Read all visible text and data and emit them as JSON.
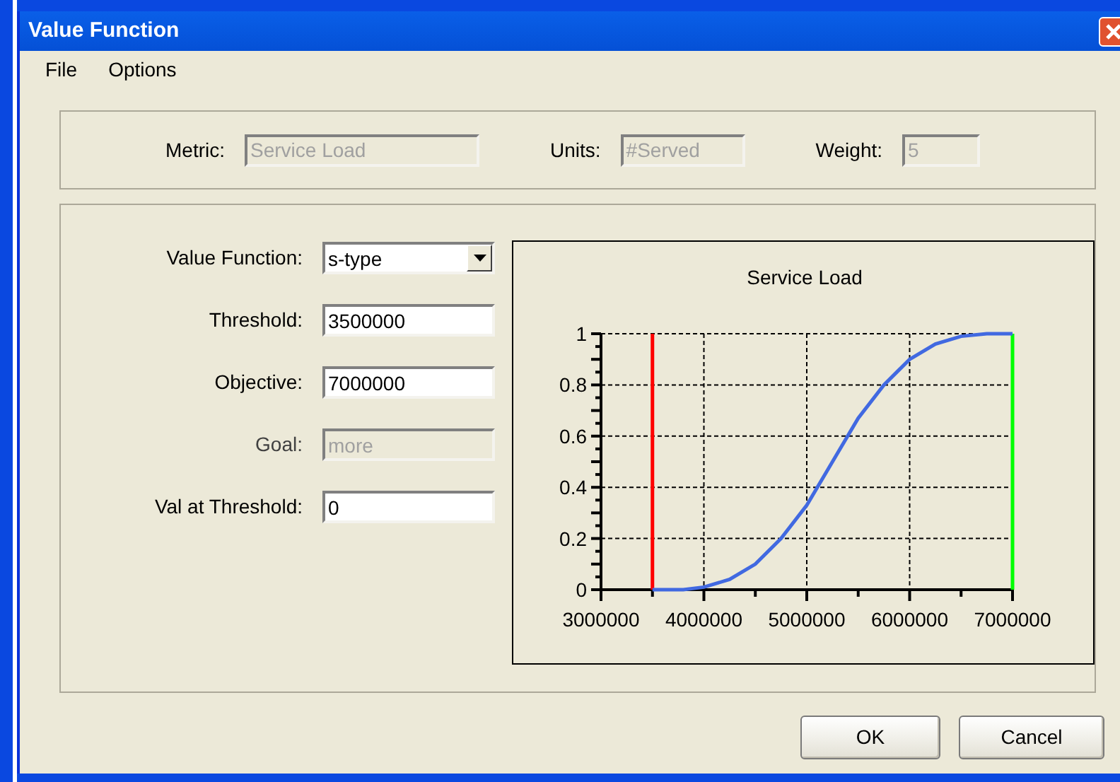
{
  "window": {
    "title": "Value Function"
  },
  "menu": [
    {
      "label": "File"
    },
    {
      "label": "Options"
    }
  ],
  "header_fields": [
    {
      "label": "Metric:",
      "value": "Service Load",
      "disabled": true
    },
    {
      "label": "Units:",
      "value": "#Served",
      "disabled": true
    },
    {
      "label": "Weight:",
      "value": "5",
      "disabled": true
    }
  ],
  "form_fields": [
    {
      "kind": "select",
      "label": "Value Function:",
      "value": "s-type",
      "disabled": false
    },
    {
      "kind": "text",
      "label": "Threshold:",
      "value": "3500000",
      "disabled": false
    },
    {
      "kind": "text",
      "label": "Objective:",
      "value": "7000000",
      "disabled": false
    },
    {
      "kind": "text",
      "label": "Goal:",
      "value": "more",
      "disabled": true
    },
    {
      "kind": "text",
      "label": "Val at Threshold:",
      "value": "0",
      "disabled": false
    }
  ],
  "chart": {
    "chart_data": {
      "type": "line",
      "title": "Service Load",
      "x": [
        3500000,
        3800000,
        4000000,
        4250000,
        4500000,
        4750000,
        5000000,
        5250000,
        5500000,
        5750000,
        6000000,
        6250000,
        6500000,
        6750000,
        7000000
      ],
      "series": [
        {
          "color": "#4169e1",
          "values": [
            0,
            0,
            0.01,
            0.04,
            0.1,
            0.2,
            0.33,
            0.5,
            0.67,
            0.8,
            0.9,
            0.96,
            0.99,
            1,
            1
          ]
        }
      ],
      "xlim": [
        3000000,
        7000000
      ],
      "ylim": [
        0,
        1
      ],
      "xticks": [
        3000000,
        4000000,
        5000000,
        6000000,
        7000000
      ],
      "yticks": [
        {
          "value": 0,
          "label": "0"
        },
        {
          "value": 0.2,
          "label": "0.2"
        },
        {
          "value": 0.4,
          "label": "0.4"
        },
        {
          "value": 0.6,
          "label": "0.6"
        },
        {
          "value": 0.8,
          "label": "0.8"
        },
        {
          "value": 1,
          "label": "1"
        }
      ],
      "grid": true,
      "ref_lines": [
        {
          "axis": "x",
          "value": 3500000,
          "color": "#ff0000"
        },
        {
          "axis": "x",
          "value": 7000000,
          "color": "#00ff00"
        }
      ]
    }
  },
  "buttons": [
    {
      "label": "OK"
    },
    {
      "label": "Cancel"
    }
  ]
}
